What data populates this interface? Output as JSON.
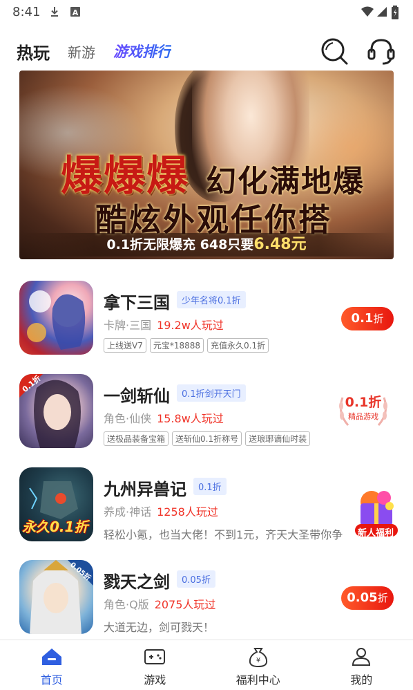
{
  "status_bar": {
    "time": "8:41"
  },
  "header": {
    "tabs": [
      {
        "label": "热玩",
        "active": true
      },
      {
        "label": "新游",
        "active": false
      },
      {
        "label": "游戏排行",
        "active": false
      }
    ],
    "icons": [
      "search-icon",
      "customer-service-icon"
    ]
  },
  "banner": {
    "headline_a": "爆爆爆",
    "headline_b": "幻化满地爆",
    "headline_c": "酷炫外观任你搭",
    "promo_prefix": "0.1折",
    "promo_mid": "无限爆充 648只要",
    "promo_price": "6.48元"
  },
  "games": [
    {
      "name": "拿下三国",
      "tag": "少年名将0.1折",
      "genre": "卡牌·三国",
      "plays": "19.2w人玩过",
      "chips": [
        "上线送V7",
        "元宝*18888",
        "充值永久0.1折"
      ],
      "discount_value": "0.1",
      "discount_unit": "折"
    },
    {
      "name": "一剑斩仙",
      "tag": "0.1折剑开天门",
      "genre": "角色·仙侠",
      "plays": "15.8w人玩过",
      "chips": [
        "送极品装备宝箱",
        "送斩仙0.1折称号",
        "送琅琊谪仙时装"
      ],
      "discount_value": "0.1折",
      "discount_sub": "精品游戏",
      "icon_badge": "0.1折"
    },
    {
      "name": "九州异兽记",
      "tag": "0.1折",
      "genre": "养成·神话",
      "plays": "1258人玩过",
      "desc": "轻松小氪，也当大佬！不到1元，齐天大圣带你争",
      "icon_caption": "永久0.1折"
    },
    {
      "name": "戮天之剑",
      "tag": "0.05折",
      "genre": "角色·Q版",
      "plays": "2075人玩过",
      "desc": "大道无边，剑可戮天！",
      "discount_value": "0.05",
      "discount_unit": "折",
      "icon_badge": "0.05折"
    }
  ],
  "floating_gift": {
    "label": "新人福利"
  },
  "bottom_nav": [
    {
      "label": "首页",
      "active": true
    },
    {
      "label": "游戏",
      "active": false
    },
    {
      "label": "福利中心",
      "active": false
    },
    {
      "label": "我的",
      "active": false
    }
  ],
  "colors": {
    "accent": "#2f5fe0",
    "discount": "#ee2a1c",
    "plays": "#f0352a"
  }
}
